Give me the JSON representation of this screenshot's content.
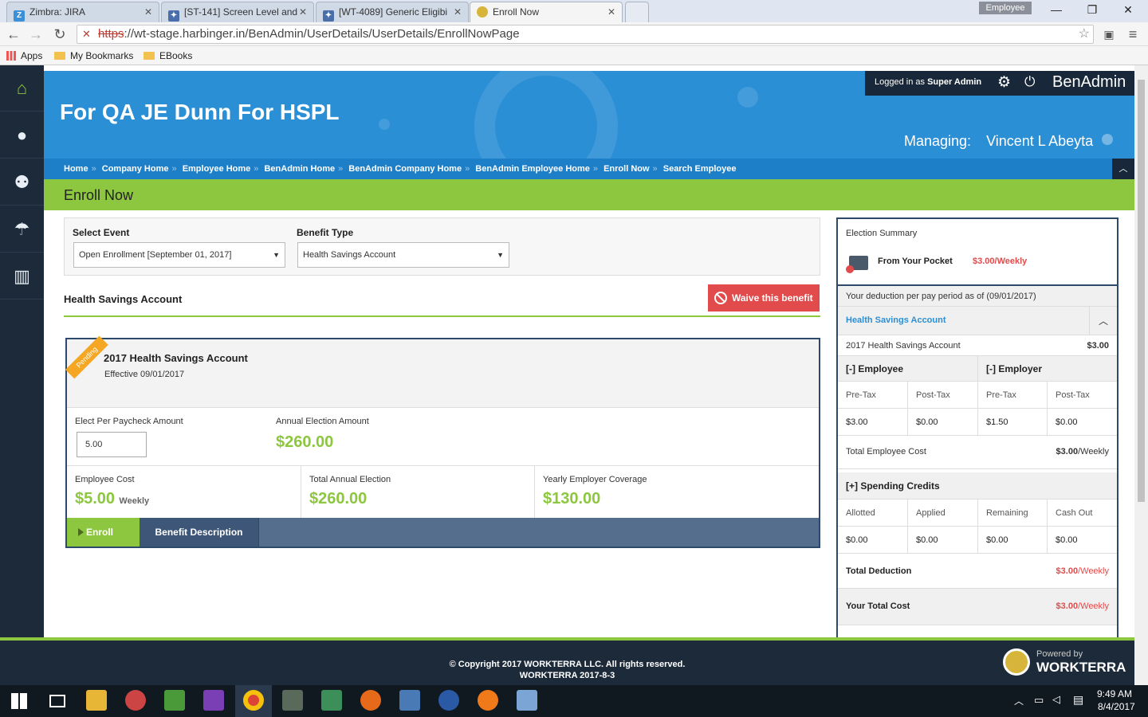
{
  "browser": {
    "tabs": [
      {
        "title": "Zimbra: JIRA",
        "icon": "zimbra-icon",
        "active": false
      },
      {
        "title": "[ST-141] Screen Level and",
        "icon": "jira-icon",
        "active": false
      },
      {
        "title": "[WT-4089] Generic Eligibi",
        "icon": "jira-icon",
        "active": false
      },
      {
        "title": "Enroll Now",
        "icon": "worktera-icon",
        "active": true
      }
    ],
    "profile": "Employee",
    "url_scheme": "https",
    "url_rest": "://wt-stage.harbinger.in/BenAdmin/UserDetails/UserDetails/EnrollNowPage",
    "bookmarks": [
      "Apps",
      "My Bookmarks",
      "EBooks"
    ]
  },
  "header": {
    "client_title": "For QA JE Dunn For HSPL",
    "logged_prefix": "Logged in as",
    "logged_role": "Super Admin",
    "app_name": "BenAdmin",
    "managing_label": "Managing:",
    "managing_name": "Vincent L Abeyta"
  },
  "breadcrumb": [
    "Home",
    "Company Home",
    "Employee Home",
    "BenAdmin Home",
    "BenAdmin Company Home",
    "BenAdmin Employee Home",
    "Enroll Now",
    "Search Employee"
  ],
  "page_title": "Enroll Now",
  "filters": {
    "event_label": "Select Event",
    "event_value": "Open Enrollment [September 01, 2017]",
    "type_label": "Benefit Type",
    "type_value": "Health Savings Account"
  },
  "section_heading": "Health Savings Account",
  "waive_label": "Waive this benefit",
  "plan": {
    "status": "Pending",
    "name": "2017 Health Savings Account",
    "effective": "Effective 09/01/2017",
    "elect_label": "Elect Per Paycheck Amount",
    "elect_value": "5.00",
    "annual_label": "Annual Election Amount",
    "annual_value": "$260.00",
    "employee_cost_label": "Employee Cost",
    "employee_cost_value": "$5.00",
    "employee_cost_freq": "Weekly",
    "total_annual_label": "Total Annual Election",
    "total_annual_value": "$260.00",
    "yearly_employer_label": "Yearly Employer Coverage",
    "yearly_employer_value": "$130.00",
    "enroll_label": "Enroll",
    "benefit_desc_label": "Benefit Description"
  },
  "summary": {
    "title": "Election Summary",
    "pocket_label": "From Your Pocket",
    "pocket_value": "$3.00/Weekly",
    "deduction_note": "Your deduction per pay period as of (09/01/2017)",
    "group_title": "Health Savings Account",
    "plan_name": "2017 Health Savings Account",
    "plan_amount": "$3.00",
    "employee_header": "[-] Employee",
    "employer_header": "[-] Employer",
    "cols": [
      "Pre-Tax",
      "Post-Tax",
      "Pre-Tax",
      "Post-Tax"
    ],
    "vals": [
      "$3.00",
      "$0.00",
      "$1.50",
      "$0.00"
    ],
    "total_employee_cost_label": "Total Employee Cost",
    "total_employee_cost_value": "$3.00",
    "weekly": "/Weekly",
    "spending_header": "[+] Spending Credits",
    "credit_cols": [
      "Allotted",
      "Applied",
      "Remaining",
      "Cash Out"
    ],
    "credit_vals": [
      "$0.00",
      "$0.00",
      "$0.00",
      "$0.00"
    ],
    "total_deduction_label": "Total Deduction",
    "total_deduction_value": "$3.00",
    "your_total_label": "Your Total Cost",
    "your_total_value": "$3.00"
  },
  "footer": {
    "copyright": "© Copyright 2017 WORKTERRA LLC. All rights reserved.",
    "version": "WORKTERRA 2017-8-3",
    "powered_by": "Powered by",
    "brand": "WORKTERRA"
  },
  "taskbar": {
    "time": "9:49 AM",
    "date": "8/4/2017"
  },
  "colors": {
    "accent_green": "#8dc63f",
    "header_blue": "#2b8fd6",
    "dark_navy": "#1c2a3a",
    "waive_red": "#e24b4b"
  }
}
